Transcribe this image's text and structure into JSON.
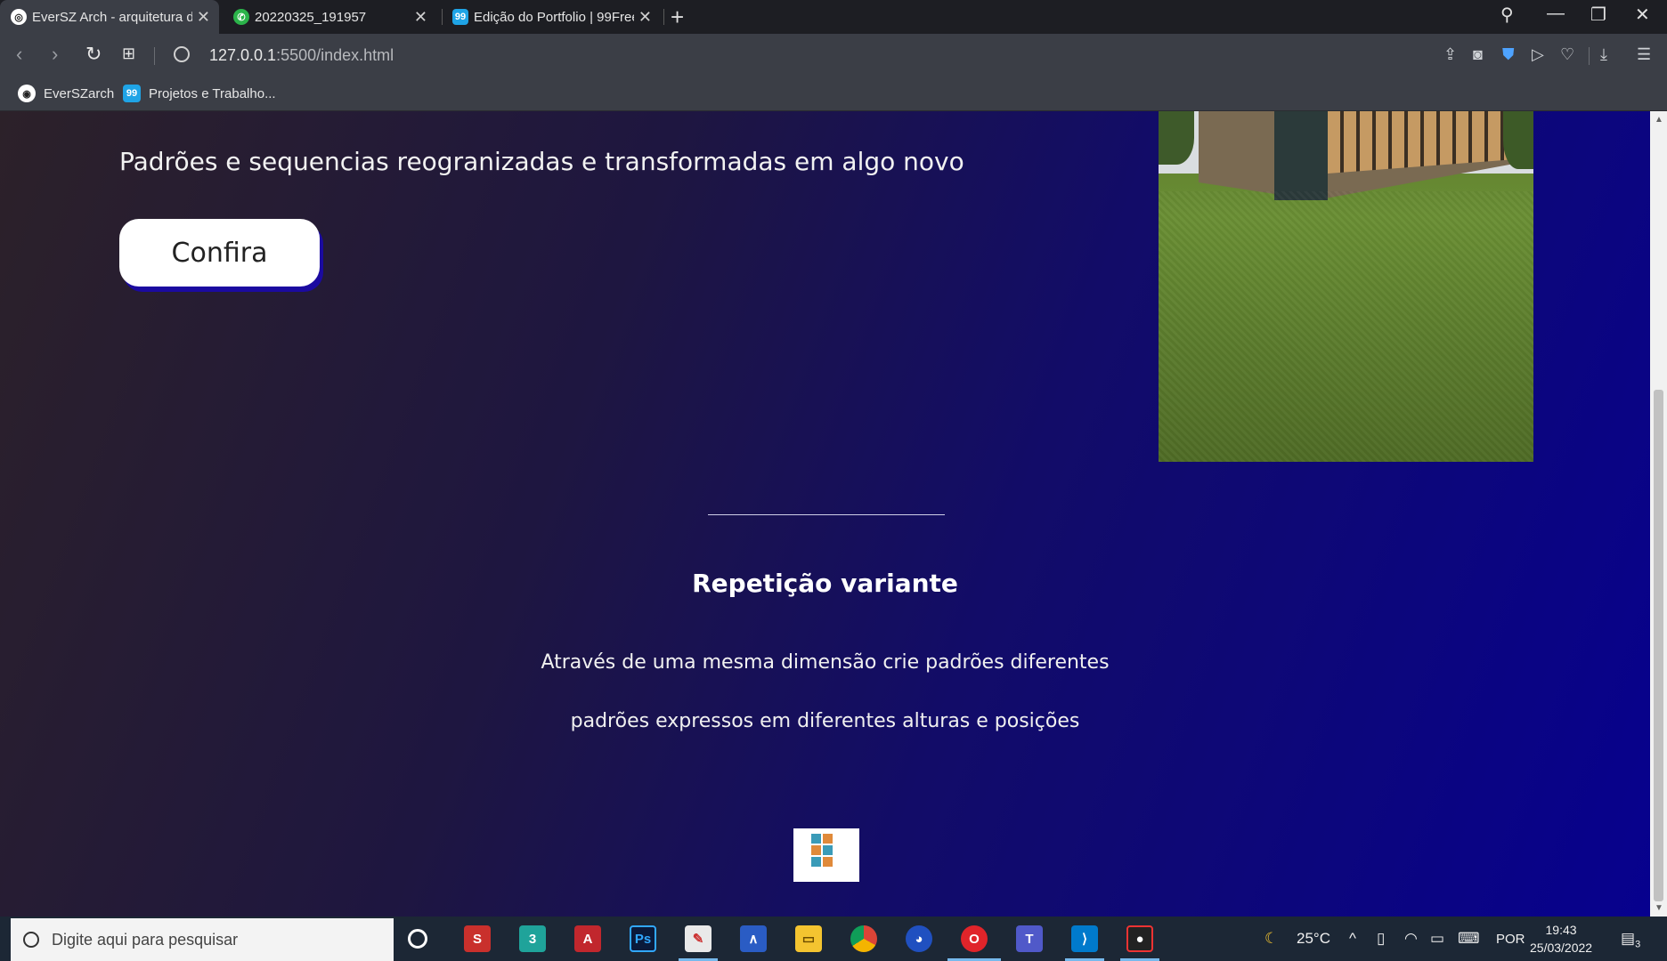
{
  "browser": {
    "tabs": [
      {
        "title": "EverSZ Arch - arquitetura d",
        "active": true
      },
      {
        "title": "20220325_191957",
        "active": false
      },
      {
        "title": "Edição do Portfolio | 99Free",
        "active": false
      }
    ],
    "url_host": "127.0.0.1",
    "url_path": ":5500/index.html",
    "bookmarks": [
      "EverSZarch",
      "Projetos e Trabalho..."
    ]
  },
  "page": {
    "hero_text": "Padrões e sequencias reogranizadas e transformadas em algo novo",
    "cta_label": "Confira",
    "section_title": "Repetição variante",
    "section_line1": "Através de uma mesma dimensão crie padrões diferentes",
    "section_line2": "padrões expressos em diferentes alturas e posições"
  },
  "taskbar": {
    "search_placeholder": "Digite aqui para pesquisar",
    "weather": "25°C",
    "language": "POR",
    "time": "19:43",
    "date": "25/03/2022",
    "notifications": "3"
  },
  "colors": {
    "page_gradient_start": "#2c2129",
    "page_gradient_end": "#07018e",
    "taskbar": "#1c2735",
    "chrome": "#3b3e46"
  }
}
